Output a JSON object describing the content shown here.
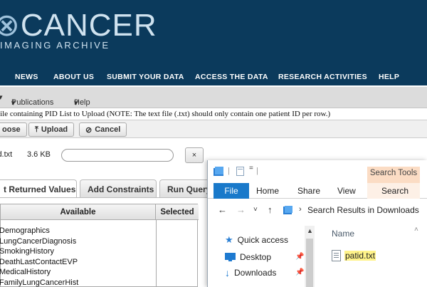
{
  "site": {
    "logo_big": "CANCER",
    "logo_small": "IMAGING ARCHIVE",
    "nav": [
      "NEWS",
      "ABOUT US",
      "SUBMIT YOUR DATA",
      "ACCESS THE DATA",
      "RESEARCH ACTIVITIES",
      "HELP"
    ]
  },
  "menubar": {
    "publications": "Publications",
    "help": "Help"
  },
  "upload": {
    "note": "File containing PID List to Upload (NOTE: The text file (.txt) should only contain one patient ID per row.)",
    "choose_label": "oose",
    "upload_label": "Upload",
    "cancel_label": "Cancel",
    "file_name": "id.txt",
    "file_size": "3.6 KB",
    "remove_label": "×"
  },
  "tabs": [
    "t Returned Values",
    "Add Constraints",
    "Run Query"
  ],
  "table": {
    "header_available": "Available",
    "header_selected": "Selected",
    "rows": [
      "Demographics",
      "LungCancerDiagnosis",
      "SmokingHistory",
      "DeathLastContactEVP",
      "MedicalHistory",
      "FamilyLungCancerHist"
    ]
  },
  "explorer": {
    "context_tab": "Search Tools",
    "ribbon": {
      "file": "File",
      "home": "Home",
      "share": "Share",
      "view": "View",
      "search": "Search"
    },
    "address": "Search Results in Downloads",
    "nav_items": [
      "Quick access",
      "Desktop",
      "Downloads"
    ],
    "column_name": "Name",
    "file_name": "patid.txt"
  },
  "colors": {
    "header_bg": "#0b3a5c",
    "file_tab": "#1979ca",
    "search_tools": "#fbdcc4",
    "highlight": "#fff38a"
  }
}
